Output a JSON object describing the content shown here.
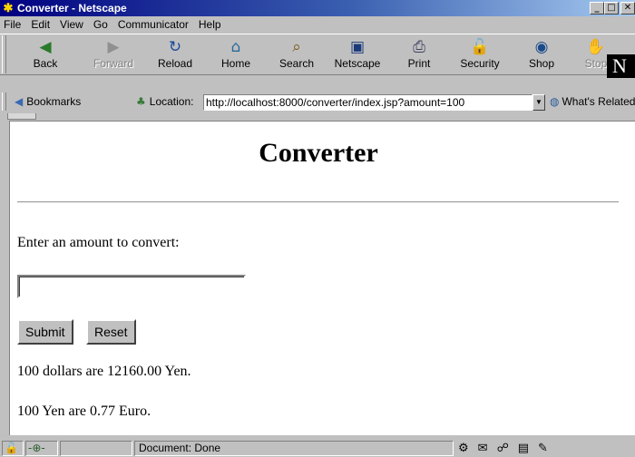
{
  "window": {
    "title": "Converter - Netscape"
  },
  "menu": [
    "File",
    "Edit",
    "View",
    "Go",
    "Communicator",
    "Help"
  ],
  "toolbar": {
    "back": "Back",
    "forward": "Forward",
    "reload": "Reload",
    "home": "Home",
    "search": "Search",
    "netscape": "Netscape",
    "print": "Print",
    "security": "Security",
    "shop": "Shop",
    "stop": "Stop"
  },
  "location": {
    "bookmarks": "Bookmarks",
    "label": "Location:",
    "url": "http://localhost:8000/converter/index.jsp?amount=100",
    "related": "What's Related"
  },
  "page": {
    "heading": "Converter",
    "prompt": "Enter an amount to convert:",
    "amount_value": "",
    "submit": "Submit",
    "reset": "Reset",
    "result_yen": "100 dollars are 12160.00 Yen.",
    "result_euro": "100 Yen are 0.77 Euro."
  },
  "status": {
    "text": "Document: Done"
  }
}
